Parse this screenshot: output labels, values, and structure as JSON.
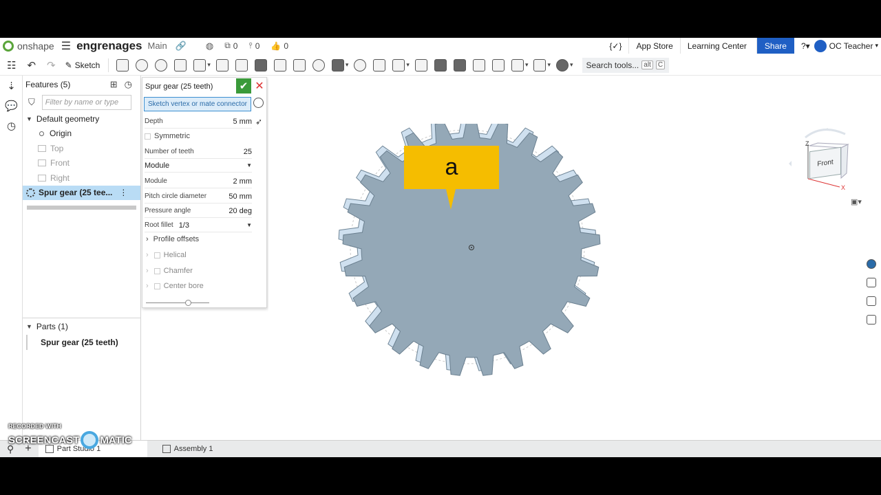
{
  "header": {
    "app_name": "onshape",
    "doc_title": "engrenages",
    "branch": "Main",
    "counts": [
      "0",
      "0",
      "0"
    ],
    "app_store": "App Store",
    "learning_center": "Learning Center",
    "share": "Share",
    "help": "?",
    "user": "OC Teacher"
  },
  "toolbar": {
    "sketch_label": "Sketch",
    "search_label": "Search tools...",
    "search_kbd_1": "alt",
    "search_kbd_2": "C"
  },
  "features": {
    "title": "Features (5)",
    "filter_placeholder": "Filter by name or type",
    "default_geometry": "Default geometry",
    "origin": "Origin",
    "top": "Top",
    "front": "Front",
    "right": "Right",
    "selected_feature": "Spur gear (25 tee..."
  },
  "parts": {
    "title": "Parts (1)",
    "item": "Spur gear (25 teeth)"
  },
  "dialog": {
    "title": "Spur gear (25 teeth)",
    "selection_prompt": "Sketch vertex or mate connector",
    "depth_label": "Depth",
    "depth_value": "5 mm",
    "symmetric_label": "Symmetric",
    "teeth_label": "Number of teeth",
    "teeth_value": "25",
    "mode_select": "Module",
    "module_label": "Module",
    "module_value": "2 mm",
    "pitch_label": "Pitch circle diameter",
    "pitch_value": "50 mm",
    "pressure_label": "Pressure angle",
    "pressure_value": "20 deg",
    "fillet_label": "Root fillet",
    "fillet_value": "1/3",
    "profile_offsets": "Profile offsets",
    "helical": "Helical",
    "chamfer": "Chamfer",
    "center_bore": "Center bore",
    "slider_fraction": 0.67
  },
  "viewport": {
    "callout_text": "a",
    "gear_teeth_count": 25,
    "gear_color": "#94a8b7",
    "callout_color": "#f5bd00"
  },
  "viewcube": {
    "face_label": "Front",
    "axis_z": "Z",
    "axis_x": "X"
  },
  "tabs": {
    "part_studio": "Part Studio 1",
    "assembly": "Assembly 1"
  },
  "watermark": {
    "top": "RECORDED WITH",
    "left": "SCREENCAST",
    "right": "MATIC"
  },
  "colors": {
    "accent": "#1f5fc4",
    "selection": "#b9dcf5",
    "confirm": "#3a9a3a",
    "cancel": "#dd3333"
  }
}
